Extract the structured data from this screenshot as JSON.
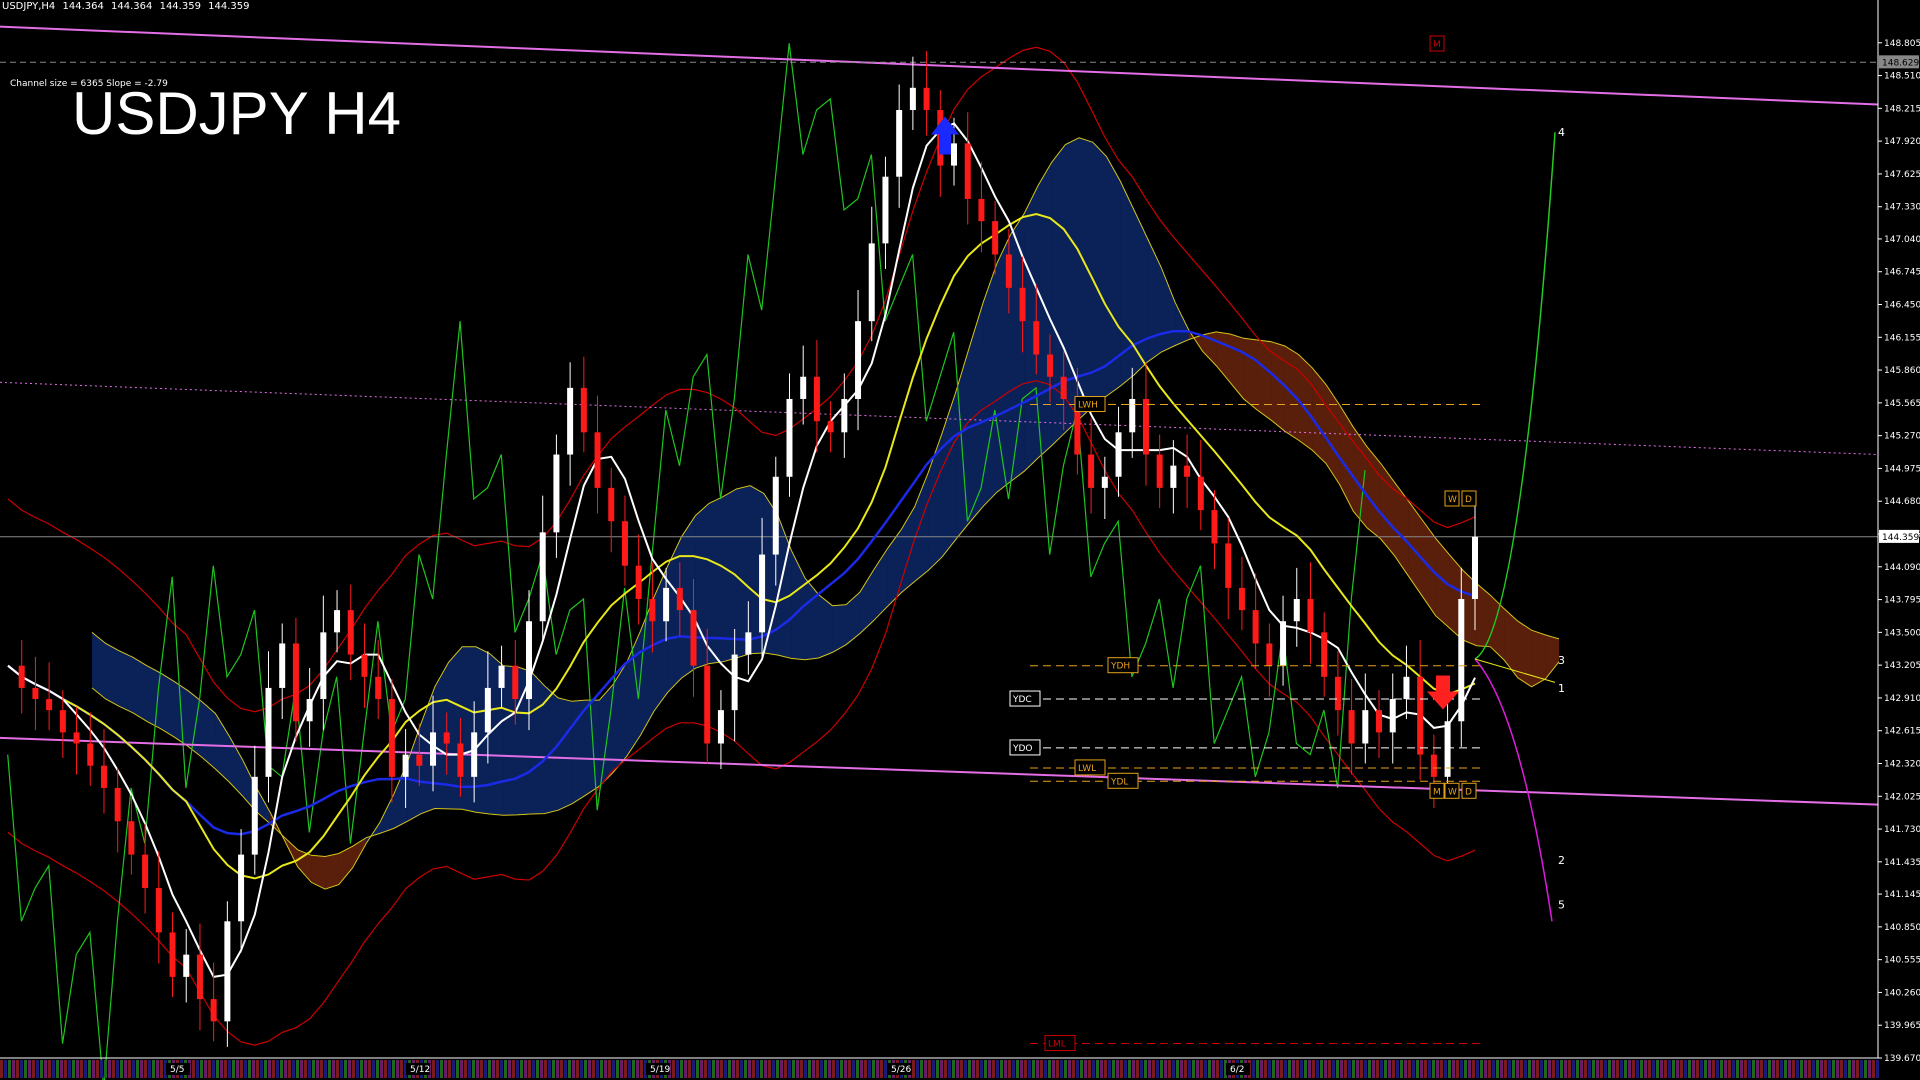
{
  "header": {
    "symbol": "USDJPY,H4",
    "open": "144.364",
    "high": "144.364",
    "low": "144.359",
    "close": "144.359"
  },
  "channel_info": "Channel size = 6365 Slope = -2.79",
  "big_title": "USDJPY H4",
  "colors": {
    "background": "#000000",
    "bull_candle": "#ffffff",
    "bear_candle": "#ff1a1a",
    "channel": "#e36ee6",
    "ma_white": "#ffffff",
    "ma_yellow": "#e8e81a",
    "ma_blue": "#1a2ae6",
    "bollinger": "#cc0000",
    "chikou": "#1fc41f",
    "cloud_bear": "#ff5a1f",
    "cloud_bull": "#2060ff",
    "gold_level": "#e6a21a",
    "projection_green": "#22cc22",
    "projection_magenta": "#e01ae0"
  },
  "chart_data": {
    "type": "line",
    "symbol": "USDJPY",
    "timeframe": "H4",
    "y_range": [
      139.67,
      149.1
    ],
    "y_ticks": [
      "148.805",
      "148.510",
      "148.215",
      "147.920",
      "147.625",
      "147.330",
      "147.040",
      "146.745",
      "146.450",
      "146.155",
      "145.860",
      "145.565",
      "145.270",
      "144.975",
      "144.680",
      "144.385",
      "144.090",
      "143.795",
      "143.500",
      "143.205",
      "142.910",
      "142.615",
      "142.320",
      "142.025",
      "141.730",
      "141.435",
      "141.145",
      "140.850",
      "140.555",
      "140.260",
      "139.965",
      "139.670"
    ],
    "x_ticks": [
      "5/5",
      "5/12",
      "5/19",
      "5/26",
      "6/2"
    ],
    "current_price": "144.359",
    "top_price_label": "148.629",
    "close_prices": [
      143.2,
      143.0,
      142.9,
      142.8,
      142.6,
      142.5,
      142.3,
      142.1,
      141.8,
      141.5,
      141.2,
      140.8,
      140.4,
      140.6,
      140.2,
      140.0,
      140.9,
      141.5,
      142.2,
      143.0,
      143.4,
      142.7,
      142.9,
      143.5,
      143.7,
      143.3,
      143.1,
      142.9,
      142.2,
      142.4,
      142.3,
      142.6,
      142.5,
      142.2,
      142.6,
      143.0,
      143.2,
      142.9,
      143.6,
      144.4,
      145.1,
      145.7,
      145.3,
      144.8,
      144.5,
      144.1,
      143.8,
      143.6,
      143.9,
      143.7,
      143.2,
      142.5,
      142.8,
      143.3,
      143.5,
      144.2,
      144.9,
      145.6,
      145.8,
      145.4,
      145.3,
      145.6,
      146.3,
      147.0,
      147.6,
      148.2,
      148.4,
      148.2,
      147.7,
      147.9,
      147.4,
      147.2,
      146.9,
      146.6,
      146.3,
      146.0,
      145.8,
      145.6,
      145.1,
      144.8,
      144.9,
      145.3,
      145.6,
      145.1,
      144.8,
      145.0,
      144.9,
      144.6,
      144.3,
      143.9,
      143.7,
      143.4,
      143.2,
      143.6,
      143.8,
      143.5,
      143.1,
      142.8,
      142.5,
      142.8,
      142.6,
      142.9,
      143.1,
      142.4,
      142.2,
      142.7,
      143.8,
      144.36
    ],
    "levels": [
      {
        "label": "LWH",
        "value": 145.55
      },
      {
        "label": "YDH",
        "value": 143.2
      },
      {
        "label": "YDC",
        "value": 142.9
      },
      {
        "label": "YDO",
        "value": 142.46
      },
      {
        "label": "LWL",
        "value": 142.28
      },
      {
        "label": "YDL",
        "value": 142.16
      },
      {
        "label": "LML",
        "value": 139.8
      }
    ],
    "projection_labels": [
      "1",
      "2",
      "3",
      "4",
      "5"
    ],
    "markers": [
      "M",
      "W",
      "D",
      "M",
      "W",
      "D",
      "M"
    ]
  }
}
